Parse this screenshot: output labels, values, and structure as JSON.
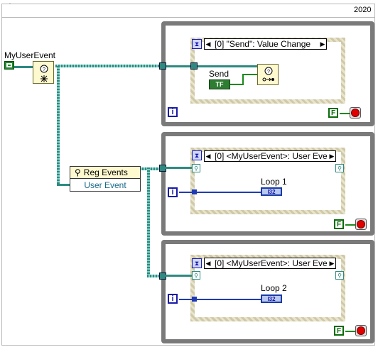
{
  "year_label": "2020",
  "toolbar": {
    "icons": [
      "hand-icon",
      "arrow-icon",
      "run-highlight-icon"
    ]
  },
  "terminal": {
    "label": "MyUserEvent",
    "type": "user-event-control"
  },
  "reg_events": {
    "title": "Reg Events",
    "input_label": "User Event"
  },
  "loop_top": {
    "event_case": "[0] \"Send\": Value Change",
    "control_label": "Send",
    "control_value": "TF",
    "iteration": "i",
    "stop_const": "F"
  },
  "loop_mid": {
    "event_case": "[0] <MyUserEvent>: User Eve",
    "indicator_label": "Loop 1",
    "indicator_type": "I32",
    "iteration": "i",
    "stop_const": "F"
  },
  "loop_bot": {
    "event_case": "[0] <MyUserEvent>: User Eve",
    "indicator_label": "Loop 2",
    "indicator_type": "I32",
    "iteration": "i",
    "stop_const": "F"
  },
  "colors": {
    "event_wire": "#2d8a80",
    "numeric_wire": "#1f3bb3",
    "boolean_wire": "#1b8a1b",
    "loop_border": "#7a7a7a",
    "stop_red": "#e00000"
  }
}
